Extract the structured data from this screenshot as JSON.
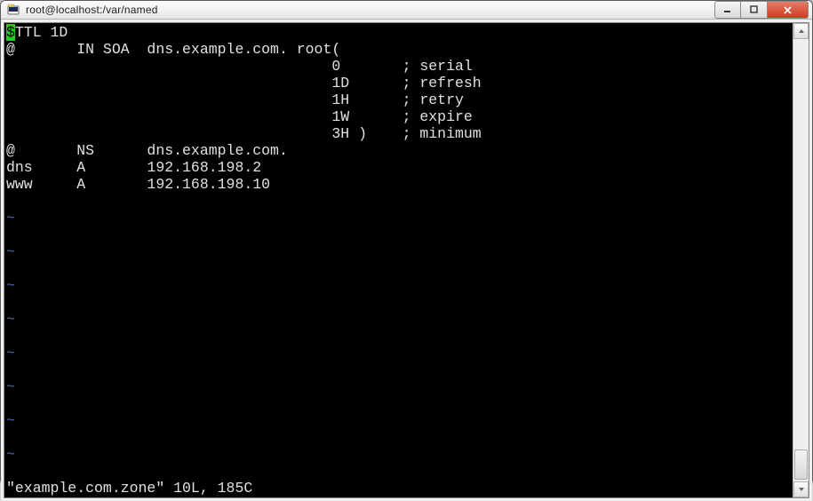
{
  "window": {
    "title": "root@localhost:/var/named"
  },
  "terminal": {
    "cursor_char": "$",
    "line1_rest": "TTL 1D",
    "line2": "@       IN SOA  dns.example.com. root(",
    "line3": "                                     0       ; serial",
    "line4": "                                     1D      ; refresh",
    "line5": "                                     1H      ; retry",
    "line6": "                                     1W      ; expire",
    "line7": "                                     3H )    ; minimum",
    "line8": "@       NS      dns.example.com.",
    "line9": "dns     A       192.168.198.2",
    "line10": "www     A       192.168.198.10",
    "tilde": "~",
    "status": "\"example.com.zone\" 10L, 185C"
  }
}
